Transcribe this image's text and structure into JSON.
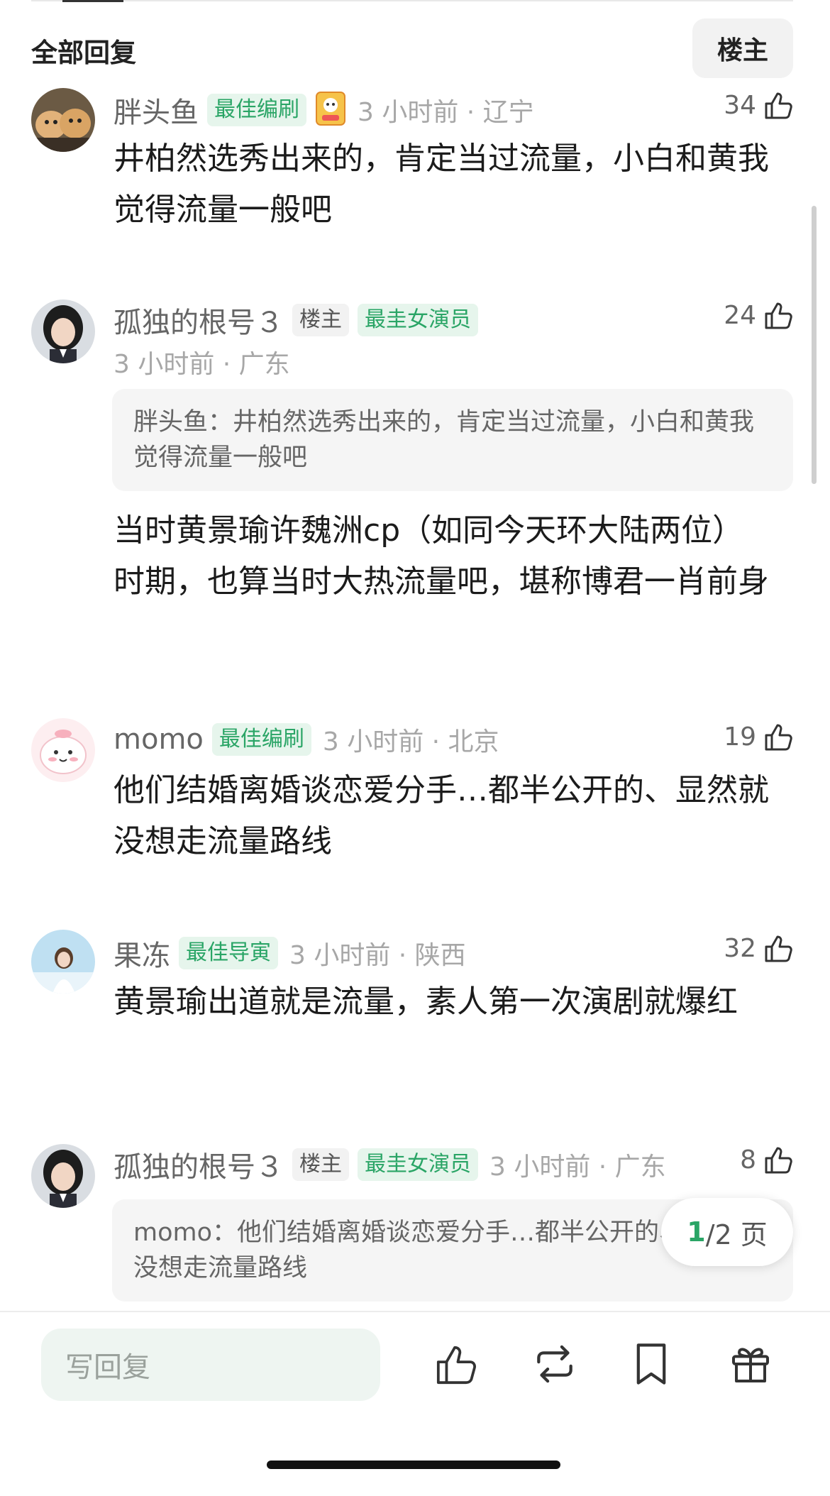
{
  "header": {
    "title": "全部回复",
    "op_filter_label": "楼主"
  },
  "comments": [
    {
      "user": "胖头鱼",
      "badges": [
        "最佳编刷"
      ],
      "meta": "3 小时前 · 辽宁",
      "likes": "34",
      "text": "井柏然选秀出来的，肯定当过流量，小白和黄我觉得流量一般吧"
    },
    {
      "user": "孤独的根号３",
      "badges": [
        "楼主",
        "最圭女演员"
      ],
      "meta": "3 小时前 · 广东",
      "likes": "24",
      "quote": "胖头鱼：井柏然选秀出来的，肯定当过流量，小白和黄我觉得流量一般吧",
      "text": "当时黄景瑜许魏洲cp（如同今天环大陆两位）时期，也算当时大热流量吧，堪称博君一肖前身"
    },
    {
      "user": "momo",
      "badges": [
        "最佳编刷"
      ],
      "meta": "3 小时前 · 北京",
      "likes": "19",
      "text": "他们结婚离婚谈恋爱分手…都半公开的、显然就没想走流量路线"
    },
    {
      "user": "果冻",
      "badges": [
        "最佳导寅"
      ],
      "meta": "3 小时前 · 陕西",
      "likes": "32",
      "text": "黄景瑜出道就是流量，素人第一次演剧就爆红"
    },
    {
      "user": "孤独的根号３",
      "badges": [
        "楼主",
        "最圭女演员"
      ],
      "meta": "3 小时前 · 广东",
      "likes": "8",
      "quote": "momo：他们结婚离婚谈恋爱分手…都半公开的、显然就没想走流量路线"
    }
  ],
  "pagination": {
    "current": "1",
    "total_text": "/2 页"
  },
  "bottom_bar": {
    "reply_placeholder": "写回复",
    "icons": [
      "like-icon",
      "repost-icon",
      "bookmark-icon",
      "gift-icon"
    ]
  },
  "colors": {
    "accent_green": "#2aa566",
    "badge_green_bg": "#e6f5ec"
  }
}
